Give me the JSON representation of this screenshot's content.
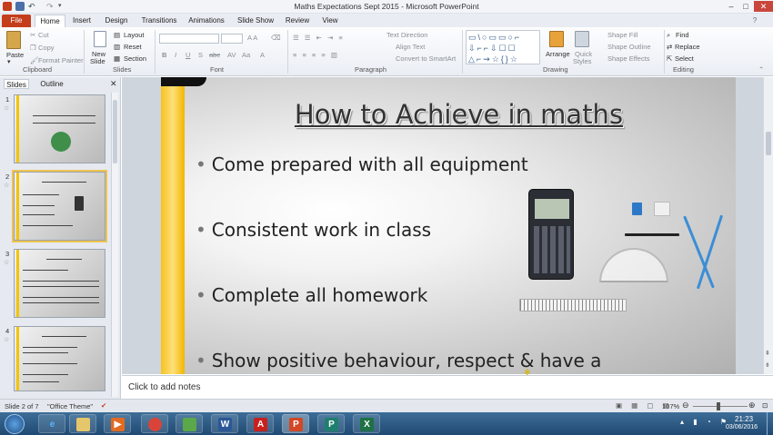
{
  "window": {
    "title": "Maths Expectations Sept 2015  -  Microsoft PowerPoint"
  },
  "tabs": [
    "File",
    "Home",
    "Insert",
    "Design",
    "Transitions",
    "Animations",
    "Slide Show",
    "Review",
    "View"
  ],
  "ribbon": {
    "clipboard": {
      "paste": "Paste",
      "cut": "Cut",
      "copy": "Copy",
      "format_painter": "Format Painter",
      "label": "Clipboard"
    },
    "slides": {
      "new_slide": "New",
      "new_slide2": "Slide",
      "layout": "Layout",
      "reset": "Reset",
      "section": "Section",
      "label": "Slides"
    },
    "font": {
      "label": "Font"
    },
    "paragraph": {
      "text_direction": "Text Direction",
      "align_text": "Align Text",
      "convert": "Convert to SmartArt",
      "label": "Paragraph"
    },
    "drawing": {
      "arrange": "Arrange",
      "quick_styles": "Quick",
      "quick_styles2": "Styles",
      "shape_fill": "Shape Fill",
      "shape_outline": "Shape Outline",
      "shape_effects": "Shape Effects",
      "label": "Drawing"
    },
    "editing": {
      "find": "Find",
      "replace": "Replace",
      "select": "Select",
      "label": "Editing"
    }
  },
  "left_pane": {
    "tabs": [
      "Slides",
      "Outline"
    ],
    "thumbnails": [
      {
        "num": "1"
      },
      {
        "num": "2"
      },
      {
        "num": "3"
      },
      {
        "num": "4"
      }
    ]
  },
  "slide": {
    "title": "How to Achieve in maths",
    "bullets": [
      "Come prepared with all equipment",
      "Consistent work in class",
      "Complete all homework",
      "Show positive behaviour, respect & have a"
    ]
  },
  "notes": {
    "placeholder": "Click to add notes"
  },
  "status": {
    "slide": "Slide 2 of 7",
    "theme": "\"Office Theme\"",
    "zoom": "107%"
  },
  "taskbar": {
    "time": "21:23",
    "date": "03/06/2016"
  },
  "colors": {
    "accent_yellow": "#f5c400",
    "file_tab": "#c43e1c",
    "taskbar": "#2a5580"
  }
}
